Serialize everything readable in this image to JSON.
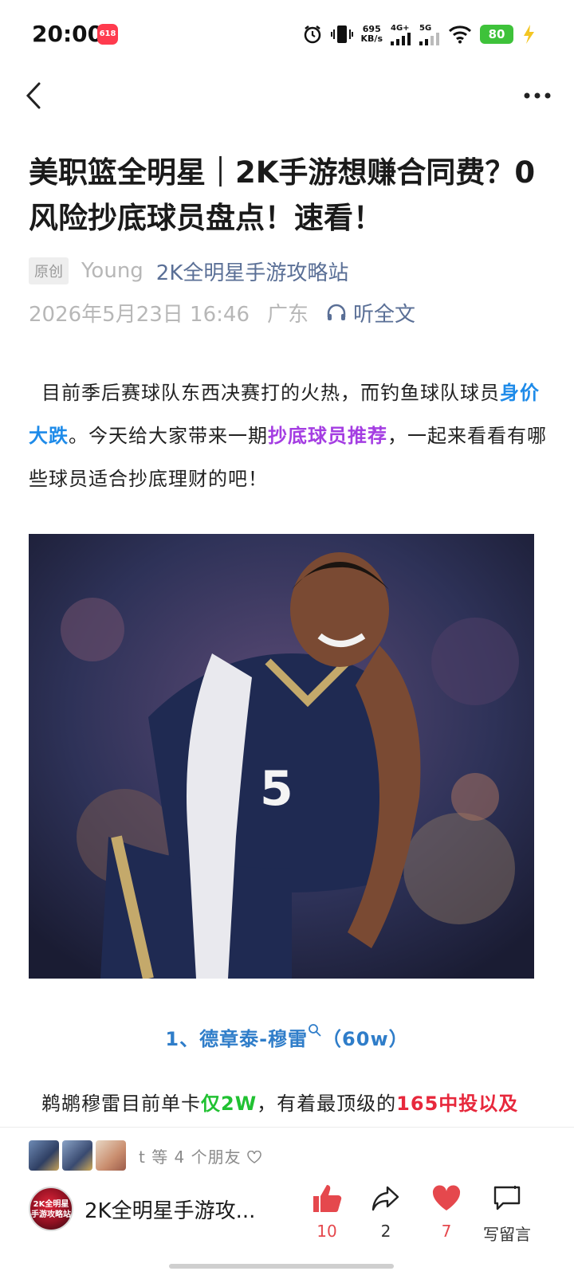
{
  "status_bar": {
    "time": "20:00",
    "app_badge": "618",
    "net_speed_value": "695",
    "net_speed_unit": "KB/s",
    "signal1_label": "4G+",
    "signal2_label": "5G",
    "battery": "80"
  },
  "article": {
    "title": "美职篮全明星｜2K手游想赚合同费？0风险抄底球员盘点！速看！",
    "original_tag": "原创",
    "author": "Young",
    "account": "2K全明星手游攻略站",
    "date": "2026年5月23日 16:46",
    "location": "广东",
    "listen_label": "听全文",
    "p1": {
      "a": "目前季后赛球队东西决赛打的火热，而钓鱼球队球员",
      "b": "身价大跌",
      "c": "。今天给大家带来一期",
      "d": "抄底球员推荐",
      "e": "，一起来看看有哪些球员适合抄底理财的吧！"
    },
    "section1": {
      "prefix": "1、德章泰-穆雷",
      "suffix": "（60w）"
    },
    "p2": {
      "a": "鹈鹕穆雷目前单卡",
      "b": "仅2W",
      "c": "，有着最顶级的",
      "d": "165中投以及"
    }
  },
  "bottom": {
    "friends_text": "t 等 4 个朋友",
    "account_name": "2K全明星手游攻...",
    "account_avatar_text": "2K全明星 手游攻略站",
    "like_count": "10",
    "share_count": "2",
    "fav_count": "7",
    "comment_label": "写留言"
  },
  "colors": {
    "link": "#5a6f96",
    "highlight_blue": "#1e8be9",
    "highlight_purple": "#a43de2",
    "highlight_green": "#21c132",
    "highlight_red": "#e7283c",
    "like_red": "#e5484d"
  }
}
